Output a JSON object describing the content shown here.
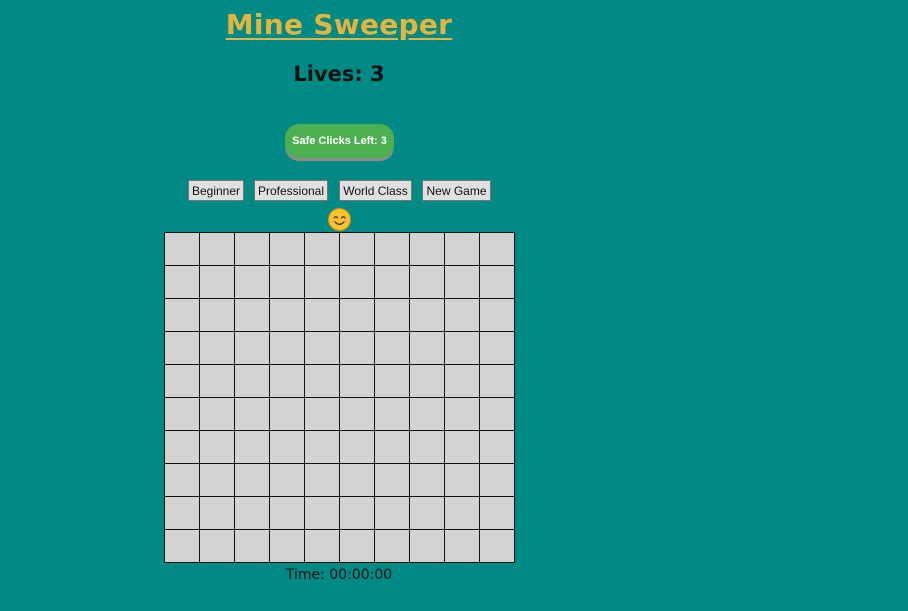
{
  "title": "Mine Sweeper",
  "lives_text": "Lives: 3",
  "safe_clicks_label": "Safe Clicks Left: 3",
  "level_buttons": [
    "Beginner",
    "Professional",
    "World Class"
  ],
  "new_game_label": "New Game",
  "smiley_icon": "smiley-face-icon",
  "board": {
    "rows": 10,
    "cols": 10,
    "cell_state": "hidden"
  },
  "timer_text": "Time: 00:00:00",
  "colors": {
    "background": "#008a85",
    "title": "#e6b33e",
    "safe_button": "#4caf50",
    "cell": "#d3d3d3"
  }
}
